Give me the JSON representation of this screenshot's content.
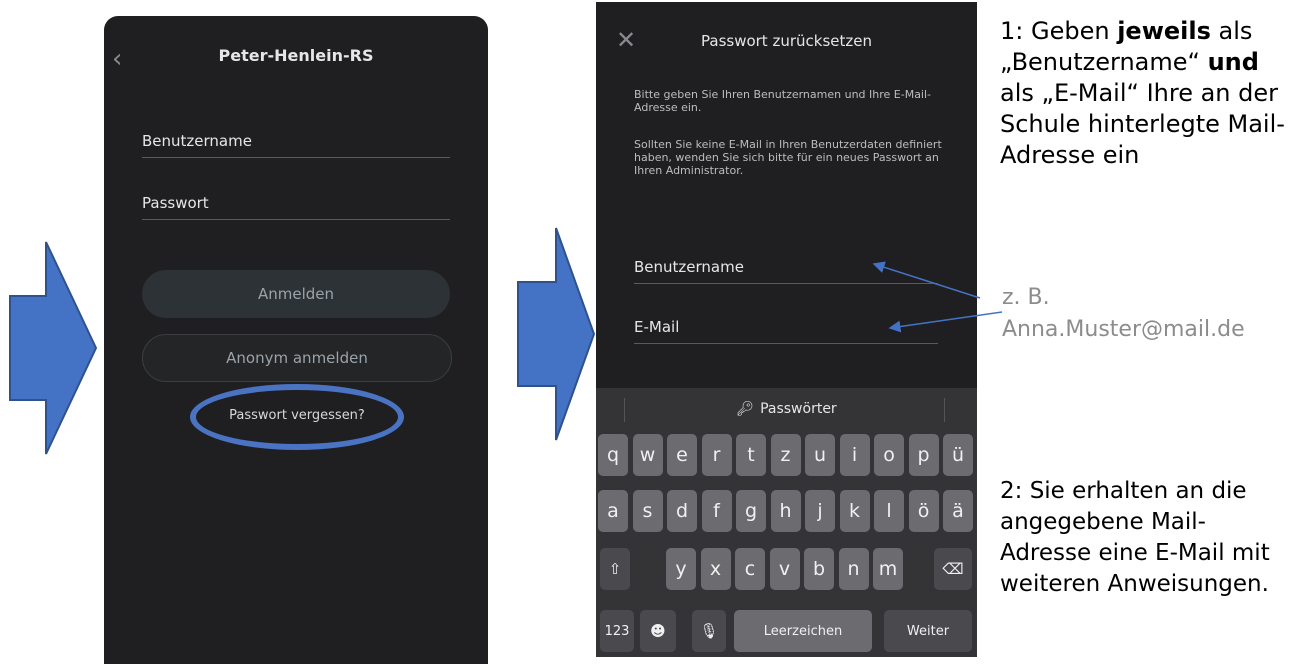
{
  "login_screen": {
    "school_name": "Peter-Henlein-RS",
    "username_label": "Benutzername",
    "password_label": "Passwort",
    "login_button": "Anmelden",
    "anonymous_button": "Anonym anmelden",
    "forgot_password_link": "Passwort vergessen?"
  },
  "reset_screen": {
    "title": "Passwort zurücksetzen",
    "instruction_1": "Bitte geben Sie Ihren Benutzernamen und Ihre E-Mail-Adresse ein.",
    "instruction_2": "Sollten Sie keine E-Mail in Ihren Benutzerdaten definiert haben, wenden Sie sich bitte für ein neues Passwort an Ihren Administrator.",
    "username_label": "Benutzername",
    "email_label": "E-Mail"
  },
  "keyboard": {
    "suggestion": "Passwörter",
    "row1": [
      "q",
      "w",
      "e",
      "r",
      "t",
      "z",
      "u",
      "i",
      "o",
      "p",
      "ü"
    ],
    "row2": [
      "a",
      "s",
      "d",
      "f",
      "g",
      "h",
      "j",
      "k",
      "l",
      "ö",
      "ä"
    ],
    "row3": [
      "y",
      "x",
      "c",
      "v",
      "b",
      "n",
      "m"
    ],
    "numbers_key": "123",
    "space_key": "Leerzeichen",
    "return_key": "Weiter"
  },
  "annotations": {
    "step1_prefix": "1: Geben ",
    "step1_bold1": "jeweils",
    "step1_mid1": " als „Benutzername“ ",
    "step1_bold2": "und",
    "step1_rest": " als „E-Mail“ Ihre an der Schule hinterlegte Mail-Adresse ein",
    "example_label": "z. B.",
    "example_email": "Anna.Muster@mail.de",
    "step2": "2: Sie erhalten an die angegebene Mail-Adresse eine E-Mail mit weiteren Anweisungen."
  },
  "colors": {
    "arrow_fill": "#4472c4",
    "phone_bg": "#1f1f21",
    "highlight": "#4a73c4"
  }
}
